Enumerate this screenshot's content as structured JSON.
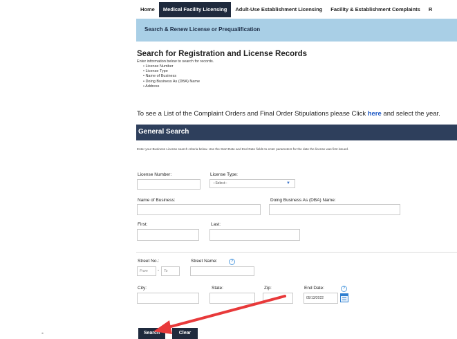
{
  "nav": {
    "tabs": [
      "Home",
      "Medical Facility Licensing",
      "Adult-Use Establishment Licensing",
      "Facility & Establishment Complaints",
      "R"
    ],
    "active_index": 1
  },
  "subbar": {
    "label": "Search & Renew License or Prequalification"
  },
  "intro": {
    "title": "Search for Registration and License Records",
    "instruction": "Enter information below to search for records.",
    "bullets": [
      "• License Number",
      "• License Type",
      "• Name of Business",
      "• Doing Business As (DBA) Name",
      "• Address"
    ]
  },
  "complaint": {
    "before": "To see a List of the Complaint Orders and Final Order Stipulations please Click ",
    "link": "here",
    "after": " and select the year."
  },
  "general": {
    "title": "General Search",
    "instructions": "Enter your Business License search criteria below.  Use the Start Date and End Date fields to enter parameters for the date the license was first issued."
  },
  "form": {
    "license_number_label": "License Number:",
    "license_type_label": "License Type:",
    "license_type_value": "--Select--",
    "business_name_label": "Name of Business:",
    "dba_label": "Doing Business As (DBA) Name:",
    "first_label": "First:",
    "last_label": "Last:",
    "street_no_label": "Street No.:",
    "street_name_label": "Street Name:",
    "from_placeholder": "From",
    "to_placeholder": "To",
    "dash": "-",
    "city_label": "City:",
    "state_label": "State:",
    "zip_label": "Zip:",
    "end_date_label": "End Date:",
    "end_date_value": "05/13/2022",
    "help_glyph": "?"
  },
  "buttons": {
    "search": "Search",
    "clear": "Clear"
  },
  "side_mark": "-",
  "colors": {
    "nav_active": "#1f2a3d",
    "subbar": "#a9cfe6",
    "general_bar": "#2e3f5c",
    "link": "#1a56c4",
    "arrow": "#e8393a"
  }
}
